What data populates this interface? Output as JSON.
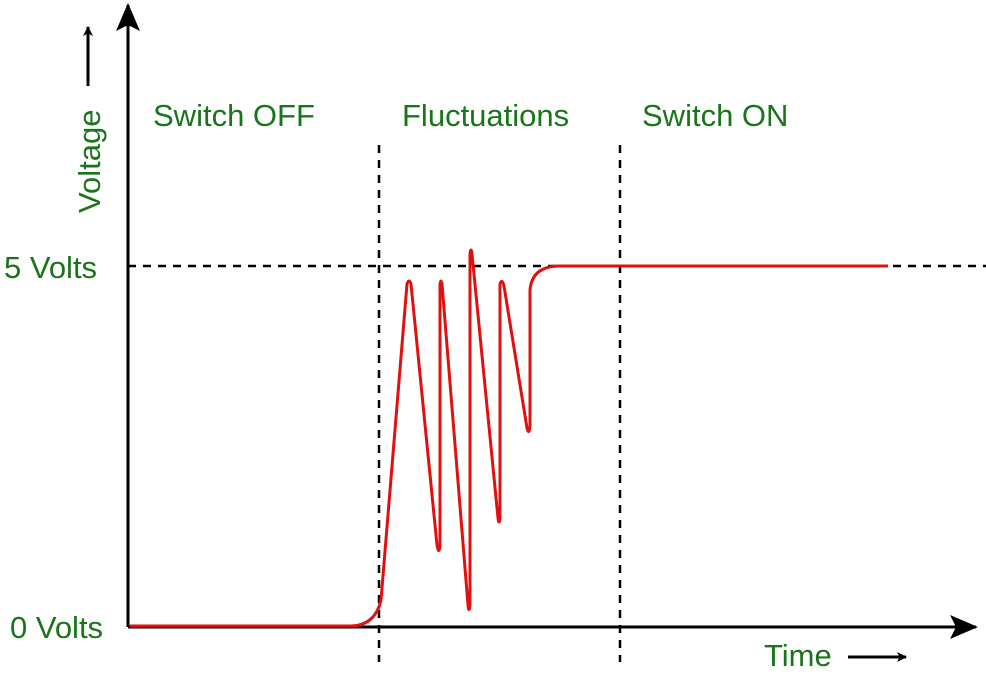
{
  "labels": {
    "y_axis": "Voltage",
    "x_axis": "Time",
    "high": "5 Volts",
    "low": "0 Volts",
    "region_off": "Switch OFF",
    "region_fluct": "Fluctuations",
    "region_on": "Switch ON"
  },
  "colors": {
    "label": "#1a741a",
    "signal": "#e01010",
    "axis": "#000000"
  }
}
